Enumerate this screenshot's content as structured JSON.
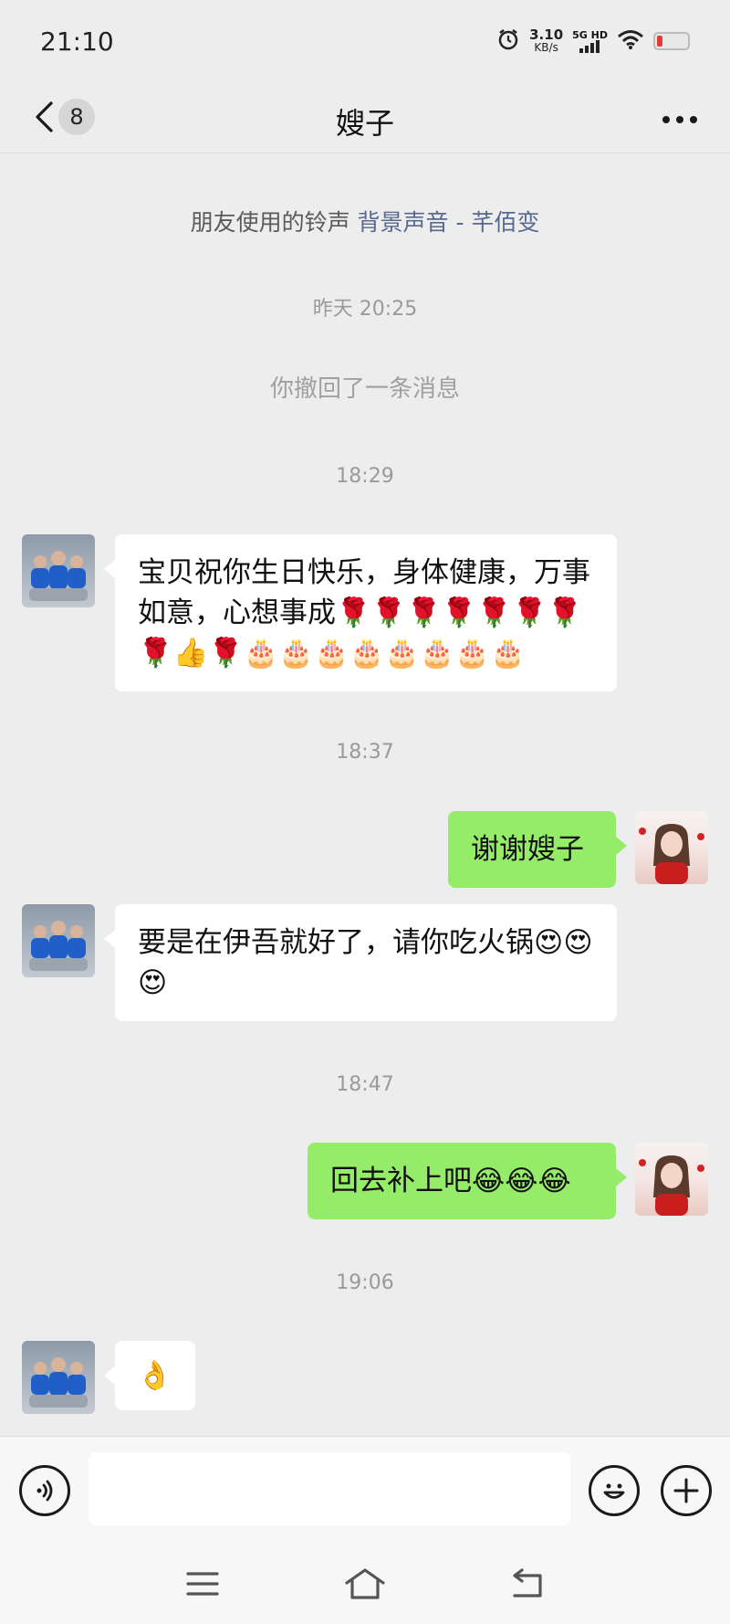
{
  "status_bar": {
    "time": "21:10",
    "net_speed_value": "3.10",
    "net_speed_unit": "KB/s",
    "signal_label": "5G HD",
    "icons": [
      "alarm-icon",
      "signal-icon",
      "wifi-icon",
      "battery-icon"
    ]
  },
  "header": {
    "unread_count": "8",
    "title": "嫂子"
  },
  "ringtone": {
    "prefix": "朋友使用的铃声 ",
    "song": "背景声音 - 芊佰变"
  },
  "messages": [
    {
      "type": "time",
      "text": "昨天 20:25"
    },
    {
      "type": "system",
      "text": "你撤回了一条消息"
    },
    {
      "type": "time",
      "text": "18:29"
    },
    {
      "type": "in",
      "text": "宝贝祝你生日快乐，身体健康，万事如意，心想事成🌹🌹🌹🌹🌹🌹🌹🌹👍🌹🎂🎂🎂🎂🎂🎂🎂🎂"
    },
    {
      "type": "time",
      "text": "18:37"
    },
    {
      "type": "out",
      "text": "谢谢嫂子"
    },
    {
      "type": "in",
      "text": "要是在伊吾就好了，请你吃火锅😍😍😍"
    },
    {
      "type": "time",
      "text": "18:47"
    },
    {
      "type": "out",
      "text": "回去补上吧😂😂😂"
    },
    {
      "type": "time",
      "text": "19:06"
    },
    {
      "type": "in",
      "text": "👌"
    }
  ],
  "input": {
    "value": "",
    "placeholder": ""
  },
  "colors": {
    "background": "#ededed",
    "bubble_out": "#95ec69",
    "bubble_in": "#ffffff",
    "link": "#56698f",
    "battery_low": "#e53935"
  }
}
